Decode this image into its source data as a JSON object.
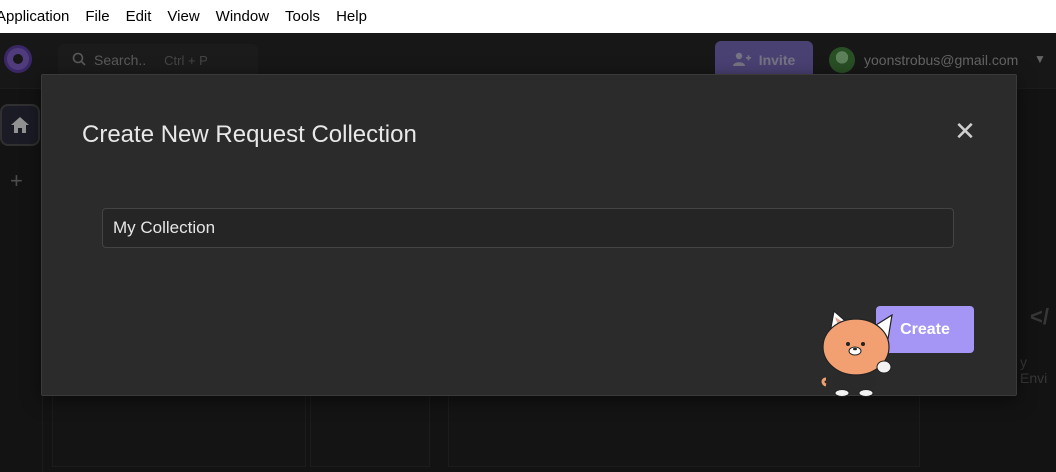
{
  "menubar": {
    "items": [
      "Application",
      "File",
      "Edit",
      "View",
      "Window",
      "Tools",
      "Help"
    ]
  },
  "topbar": {
    "search_placeholder": "Search..",
    "search_shortcut": "Ctrl + P",
    "invite_label": "Invite",
    "user_email": "yoonstrobus@gmail.com"
  },
  "background": {
    "partial_text": "y Envi",
    "code_icon": "</"
  },
  "modal": {
    "title": "Create New Request Collection",
    "close_glyph": "✕",
    "name_input_value": "My Collection",
    "create_label": "Create"
  },
  "colors": {
    "accent": "#a596f5",
    "modal_bg": "#2b2b2b",
    "page_bg": "#1e1e1e"
  }
}
